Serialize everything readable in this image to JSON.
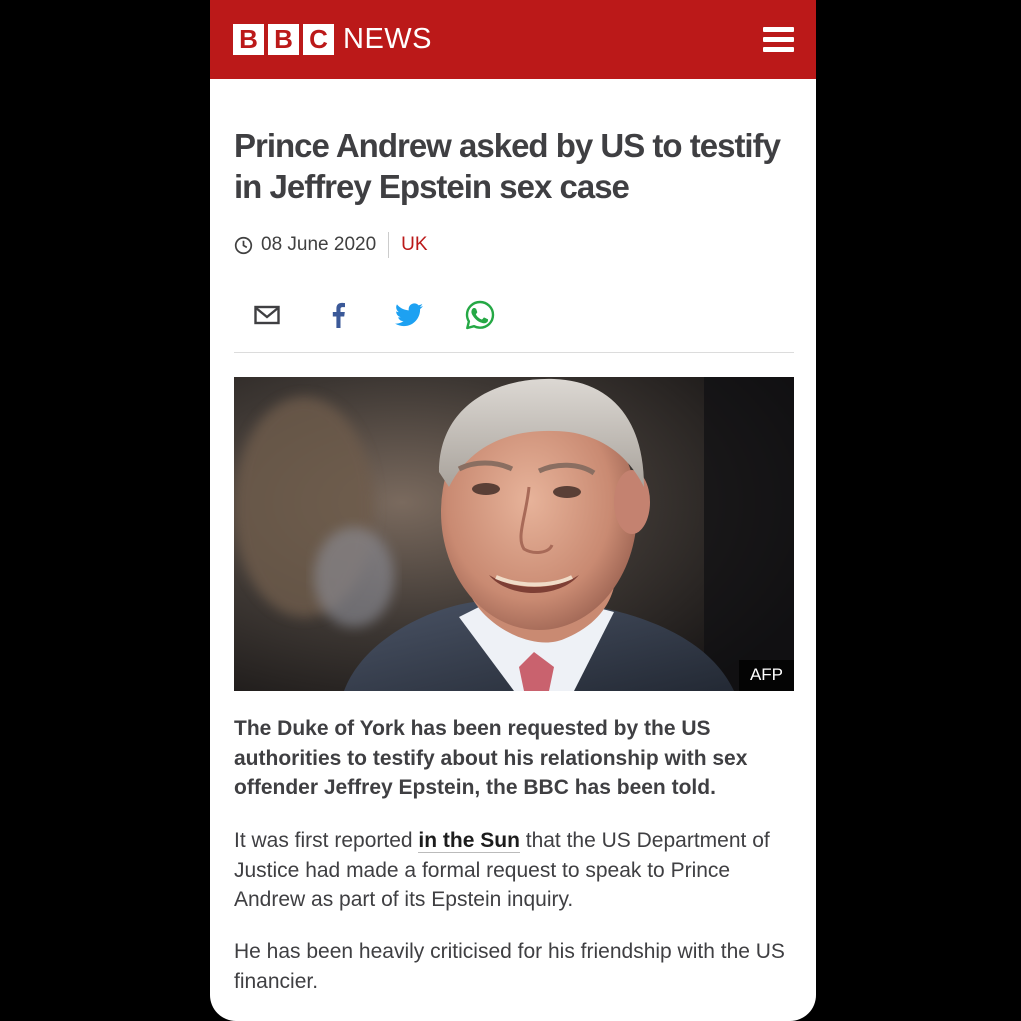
{
  "header": {
    "logo_letters": [
      "B",
      "B",
      "C"
    ],
    "logo_news": "NEWS",
    "brand_color": "#bb1919",
    "menu_icon": "hamburger-menu-icon"
  },
  "article": {
    "headline": "Prince Andrew asked by US to testify in Jeffrey Epstein sex case",
    "date": "08 June 2020",
    "section": "UK",
    "share_icons": [
      "email-icon",
      "facebook-icon",
      "twitter-icon",
      "whatsapp-icon"
    ],
    "image": {
      "subject": "Prince Andrew portrait",
      "credit": "AFP"
    },
    "intro": "The Duke of York has been requested by the US authorities to testify about his relationship with sex offender Jeffrey Epstein, the BBC has been told.",
    "para1": {
      "before": "It was first reported ",
      "link": "in the Sun",
      "after": " that the US Department of Justice had made a formal request to speak to Prince Andrew as part of its Epstein inquiry."
    },
    "para2": "He has been heavily criticised for his friendship with the US financier."
  }
}
